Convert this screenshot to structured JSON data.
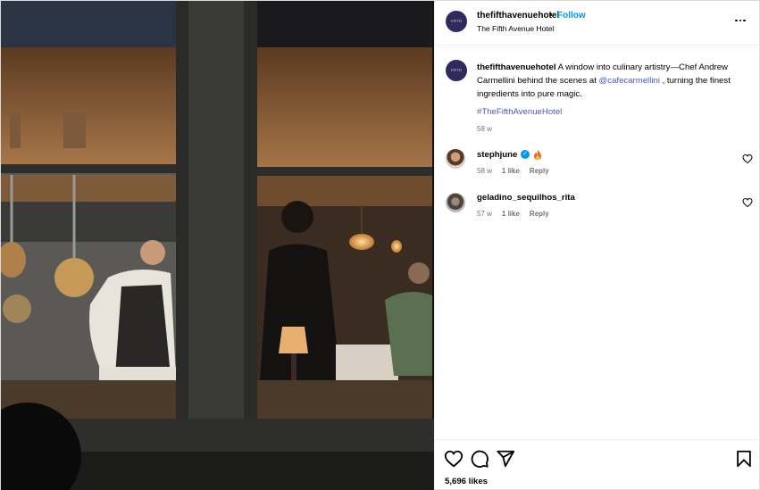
{
  "header": {
    "username": "thefifthavenuehotel",
    "separator": "•",
    "follow_label": "Follow",
    "subtitle": "The Fifth Avenue Hotel",
    "avatar_monogram": "FIFTH"
  },
  "caption": {
    "username": "thefifthavenuehotel",
    "text_before": "A window into culinary artistry—Chef Andrew Carmellini behind the scenes at",
    "mention": "@cafecarmellini",
    "text_after": ", turning the finest ingredients into pure magic.",
    "hashtag": "#TheFifthAvenueHotel",
    "time": "58 w"
  },
  "comments": [
    {
      "username": "stephjune",
      "verified": true,
      "emoji": "fire",
      "time": "58 w",
      "likes": "1 like",
      "reply": "Reply"
    },
    {
      "username": "geladino_sequilhos_rita",
      "verified": false,
      "time": "57 w",
      "likes": "1 like",
      "reply": "Reply"
    }
  ],
  "footer": {
    "likes": "5,696 likes"
  },
  "icons": {
    "more": "more-horizontal-icon",
    "like": "heart-icon",
    "comment": "comment-icon",
    "share": "send-icon",
    "save": "bookmark-icon"
  },
  "colors": {
    "link": "#0095f6",
    "mention": "#4759c9",
    "meta": "#737373",
    "avatar": "#2d2a5e"
  }
}
